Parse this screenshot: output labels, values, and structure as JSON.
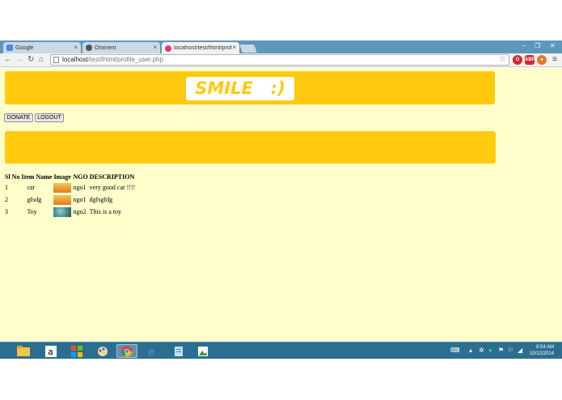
{
  "browser": {
    "tabs": [
      {
        "label": "Google",
        "favicon_color": "#4a86e8"
      },
      {
        "label": "Ominent",
        "favicon_color": "#555555"
      },
      {
        "label": "localhost/test/lhtml/prof",
        "favicon_color": "#e2396e"
      }
    ],
    "url_host": "localhost",
    "url_path": "/test/lhtml/profile_user.php"
  },
  "page": {
    "logo_text": "SMILE   :)",
    "donate_label": "DONATE",
    "logout_label": "LOGOUT",
    "table": {
      "headers": [
        "Sl No",
        "Item Name",
        "Image",
        "NGO",
        "DESCRIPTION"
      ],
      "rows": [
        {
          "sl": "1",
          "item": "car",
          "ngo": "ngo1",
          "desc": "very good car !!!!",
          "thumb": "#e8952a"
        },
        {
          "sl": "2",
          "item": "gfsdg",
          "ngo": "ngo1",
          "desc": "dgfsgfdg",
          "thumb": "#e8952a"
        },
        {
          "sl": "3",
          "item": "Toy",
          "ngo": "ngo2",
          "desc": "This is a toy",
          "thumb": "#2a6e7a"
        }
      ]
    }
  },
  "taskbar": {
    "clock_time": "8:54 AM",
    "clock_date": "10/12/2014"
  }
}
